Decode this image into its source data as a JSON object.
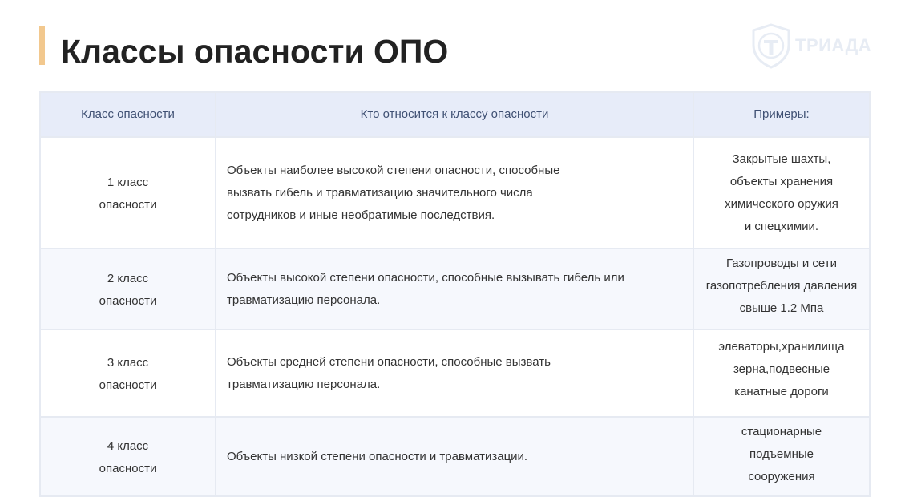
{
  "page_title": "Классы опасности ОПО",
  "logo": {
    "text": "ТРИАДА",
    "icon": "shield-t-icon",
    "color": "#e7ecf4"
  },
  "colors": {
    "title_accent": "#f2c88e",
    "header_bg": "#e7ecf9",
    "header_text": "#3f5073",
    "row_alt_bg": "#f6f8fd",
    "border": "#e6eaf2"
  },
  "table": {
    "headers": [
      "Класс опасности",
      "Кто относится к классу опасности",
      "Примеры:"
    ],
    "rows": [
      {
        "class_lines": [
          "1 класс",
          "опасности"
        ],
        "desc_lines": [
          "Объекты наиболее высокой степени опасности, способные",
          "вызвать гибель и травматизацию значительного числа",
          "сотрудников и иные необратимые последствия."
        ],
        "example_lines": [
          "Закрытые шахты,",
          "объекты хранения",
          "химического оружия",
          "и спецхимии."
        ]
      },
      {
        "class_lines": [
          "2 класс",
          "опасности"
        ],
        "desc_lines": [
          "Объекты высокой степени опасности, способные вызывать гибель или",
          "травматизацию персонала."
        ],
        "example_lines": [
          "Газопроводы и сети",
          "газопотребления давления",
          "свыше 1.2 Мпа"
        ]
      },
      {
        "class_lines": [
          "3 класс",
          "опасности"
        ],
        "desc_lines": [
          "Объекты средней степени опасности, способные вызвать",
          "травматизацию персонала."
        ],
        "example_lines": [
          "элеваторы,хранилища",
          "зерна,подвесные",
          "канатные дороги"
        ]
      },
      {
        "class_lines": [
          "4 класс",
          "опасности"
        ],
        "desc_lines": [
          "Объекты низкой степени опасности и травматизации."
        ],
        "example_lines": [
          "стационарные",
          "подъемные",
          "сооружения"
        ]
      }
    ]
  }
}
